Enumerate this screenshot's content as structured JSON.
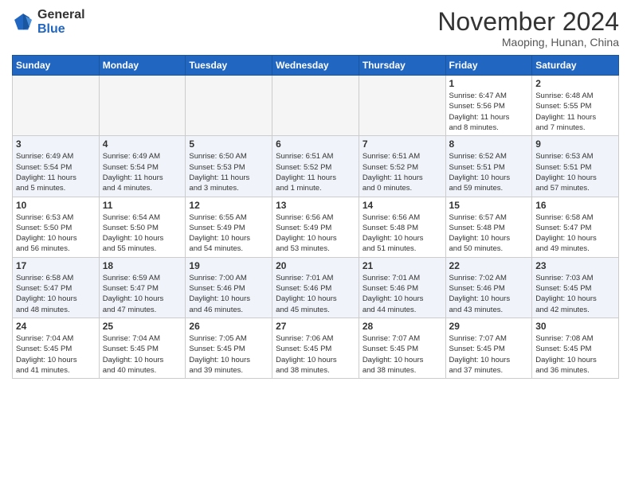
{
  "header": {
    "logo_general": "General",
    "logo_blue": "Blue",
    "month_title": "November 2024",
    "location": "Maoping, Hunan, China"
  },
  "weekdays": [
    "Sunday",
    "Monday",
    "Tuesday",
    "Wednesday",
    "Thursday",
    "Friday",
    "Saturday"
  ],
  "weeks": [
    [
      {
        "day": "",
        "info": ""
      },
      {
        "day": "",
        "info": ""
      },
      {
        "day": "",
        "info": ""
      },
      {
        "day": "",
        "info": ""
      },
      {
        "day": "",
        "info": ""
      },
      {
        "day": "1",
        "info": "Sunrise: 6:47 AM\nSunset: 5:56 PM\nDaylight: 11 hours\nand 8 minutes."
      },
      {
        "day": "2",
        "info": "Sunrise: 6:48 AM\nSunset: 5:55 PM\nDaylight: 11 hours\nand 7 minutes."
      }
    ],
    [
      {
        "day": "3",
        "info": "Sunrise: 6:49 AM\nSunset: 5:54 PM\nDaylight: 11 hours\nand 5 minutes."
      },
      {
        "day": "4",
        "info": "Sunrise: 6:49 AM\nSunset: 5:54 PM\nDaylight: 11 hours\nand 4 minutes."
      },
      {
        "day": "5",
        "info": "Sunrise: 6:50 AM\nSunset: 5:53 PM\nDaylight: 11 hours\nand 3 minutes."
      },
      {
        "day": "6",
        "info": "Sunrise: 6:51 AM\nSunset: 5:52 PM\nDaylight: 11 hours\nand 1 minute."
      },
      {
        "day": "7",
        "info": "Sunrise: 6:51 AM\nSunset: 5:52 PM\nDaylight: 11 hours\nand 0 minutes."
      },
      {
        "day": "8",
        "info": "Sunrise: 6:52 AM\nSunset: 5:51 PM\nDaylight: 10 hours\nand 59 minutes."
      },
      {
        "day": "9",
        "info": "Sunrise: 6:53 AM\nSunset: 5:51 PM\nDaylight: 10 hours\nand 57 minutes."
      }
    ],
    [
      {
        "day": "10",
        "info": "Sunrise: 6:53 AM\nSunset: 5:50 PM\nDaylight: 10 hours\nand 56 minutes."
      },
      {
        "day": "11",
        "info": "Sunrise: 6:54 AM\nSunset: 5:50 PM\nDaylight: 10 hours\nand 55 minutes."
      },
      {
        "day": "12",
        "info": "Sunrise: 6:55 AM\nSunset: 5:49 PM\nDaylight: 10 hours\nand 54 minutes."
      },
      {
        "day": "13",
        "info": "Sunrise: 6:56 AM\nSunset: 5:49 PM\nDaylight: 10 hours\nand 53 minutes."
      },
      {
        "day": "14",
        "info": "Sunrise: 6:56 AM\nSunset: 5:48 PM\nDaylight: 10 hours\nand 51 minutes."
      },
      {
        "day": "15",
        "info": "Sunrise: 6:57 AM\nSunset: 5:48 PM\nDaylight: 10 hours\nand 50 minutes."
      },
      {
        "day": "16",
        "info": "Sunrise: 6:58 AM\nSunset: 5:47 PM\nDaylight: 10 hours\nand 49 minutes."
      }
    ],
    [
      {
        "day": "17",
        "info": "Sunrise: 6:58 AM\nSunset: 5:47 PM\nDaylight: 10 hours\nand 48 minutes."
      },
      {
        "day": "18",
        "info": "Sunrise: 6:59 AM\nSunset: 5:47 PM\nDaylight: 10 hours\nand 47 minutes."
      },
      {
        "day": "19",
        "info": "Sunrise: 7:00 AM\nSunset: 5:46 PM\nDaylight: 10 hours\nand 46 minutes."
      },
      {
        "day": "20",
        "info": "Sunrise: 7:01 AM\nSunset: 5:46 PM\nDaylight: 10 hours\nand 45 minutes."
      },
      {
        "day": "21",
        "info": "Sunrise: 7:01 AM\nSunset: 5:46 PM\nDaylight: 10 hours\nand 44 minutes."
      },
      {
        "day": "22",
        "info": "Sunrise: 7:02 AM\nSunset: 5:46 PM\nDaylight: 10 hours\nand 43 minutes."
      },
      {
        "day": "23",
        "info": "Sunrise: 7:03 AM\nSunset: 5:45 PM\nDaylight: 10 hours\nand 42 minutes."
      }
    ],
    [
      {
        "day": "24",
        "info": "Sunrise: 7:04 AM\nSunset: 5:45 PM\nDaylight: 10 hours\nand 41 minutes."
      },
      {
        "day": "25",
        "info": "Sunrise: 7:04 AM\nSunset: 5:45 PM\nDaylight: 10 hours\nand 40 minutes."
      },
      {
        "day": "26",
        "info": "Sunrise: 7:05 AM\nSunset: 5:45 PM\nDaylight: 10 hours\nand 39 minutes."
      },
      {
        "day": "27",
        "info": "Sunrise: 7:06 AM\nSunset: 5:45 PM\nDaylight: 10 hours\nand 38 minutes."
      },
      {
        "day": "28",
        "info": "Sunrise: 7:07 AM\nSunset: 5:45 PM\nDaylight: 10 hours\nand 38 minutes."
      },
      {
        "day": "29",
        "info": "Sunrise: 7:07 AM\nSunset: 5:45 PM\nDaylight: 10 hours\nand 37 minutes."
      },
      {
        "day": "30",
        "info": "Sunrise: 7:08 AM\nSunset: 5:45 PM\nDaylight: 10 hours\nand 36 minutes."
      }
    ]
  ]
}
